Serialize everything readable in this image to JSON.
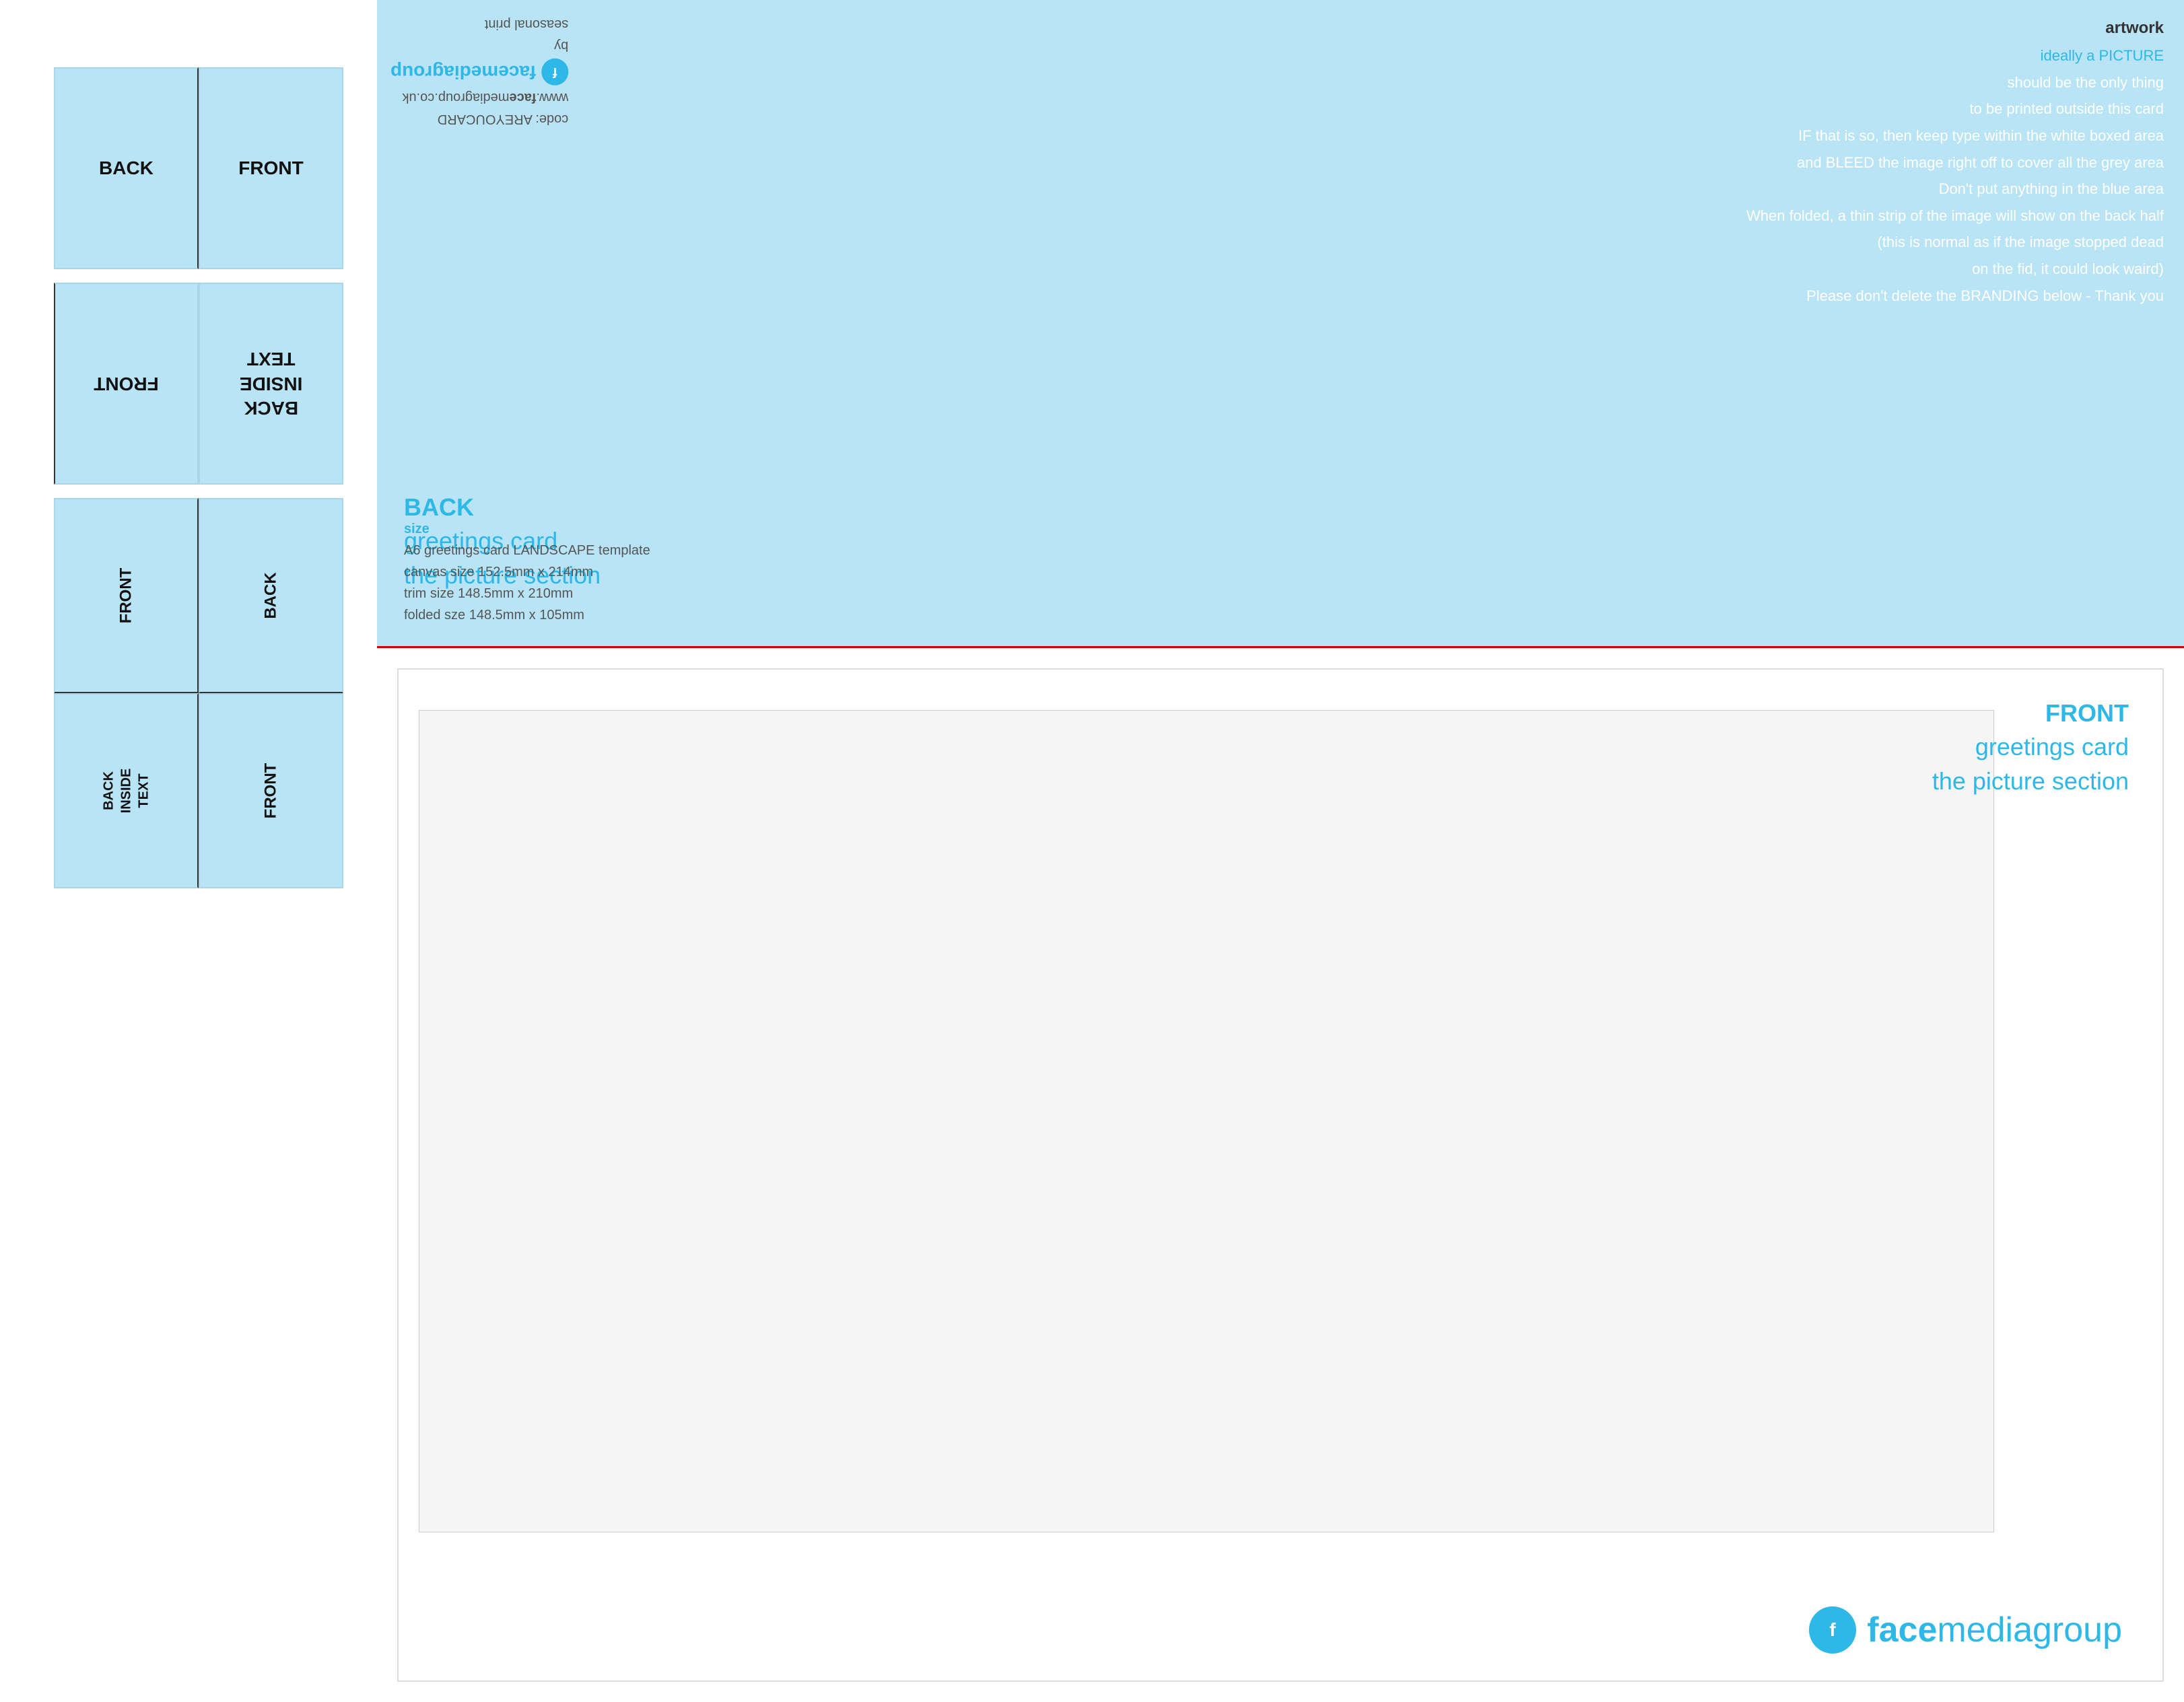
{
  "left_panel": {
    "row1": {
      "back_label": "BACK",
      "front_label": "FRONT"
    },
    "row2": {
      "front_flip_label": "FRONT",
      "back_inside_label": "BACK\nINSIDE\nTEXT"
    },
    "row3": {
      "left_label": "FRONT",
      "right_label": "BACK"
    },
    "row4": {
      "left_label": "BACK\nINSIDE\nTEXT",
      "right_label": "FRONT"
    }
  },
  "right_panel": {
    "upside_down": {
      "line1": "code: AREYOUCARD",
      "line2": "www.facemediagroup.co.uk",
      "line3": "facemediagroup",
      "line4": "by",
      "line5": "seasonal print"
    },
    "artwork": {
      "title": "artwork",
      "line1": "ideally a PICTURE",
      "line2": "should be the only thing",
      "line3": "to be printed outside this card",
      "line4": "IF that is so, then keep type within the white boxed area",
      "line5": "and BLEED the image right off to cover all the grey area",
      "line6": "Don't put anything in the blue area",
      "line7": "When folded, a thin strip of the image will show on the back half",
      "line8": "(this is normal as if the image stopped dead",
      "line9": "on the fid, it could look waird)",
      "line10": "Please don't delete the BRANDING below - Thank you"
    },
    "back_section": {
      "label": "BACK",
      "greeting": "greetings card",
      "picture": "the picture section"
    },
    "size_section": {
      "label": "size",
      "line1": "A6 greetings card LANDSCAPE template",
      "line2": "canvas size 152.5mm x 214mm",
      "line3": "trim size 148.5mm x 210mm",
      "line4": "folded sze 148.5mm x 105mm"
    },
    "front_section": {
      "label": "FRONT",
      "greeting": "greetings card",
      "picture": "the picture section"
    },
    "logo": {
      "face": "face",
      "media": "mediagroup"
    }
  }
}
